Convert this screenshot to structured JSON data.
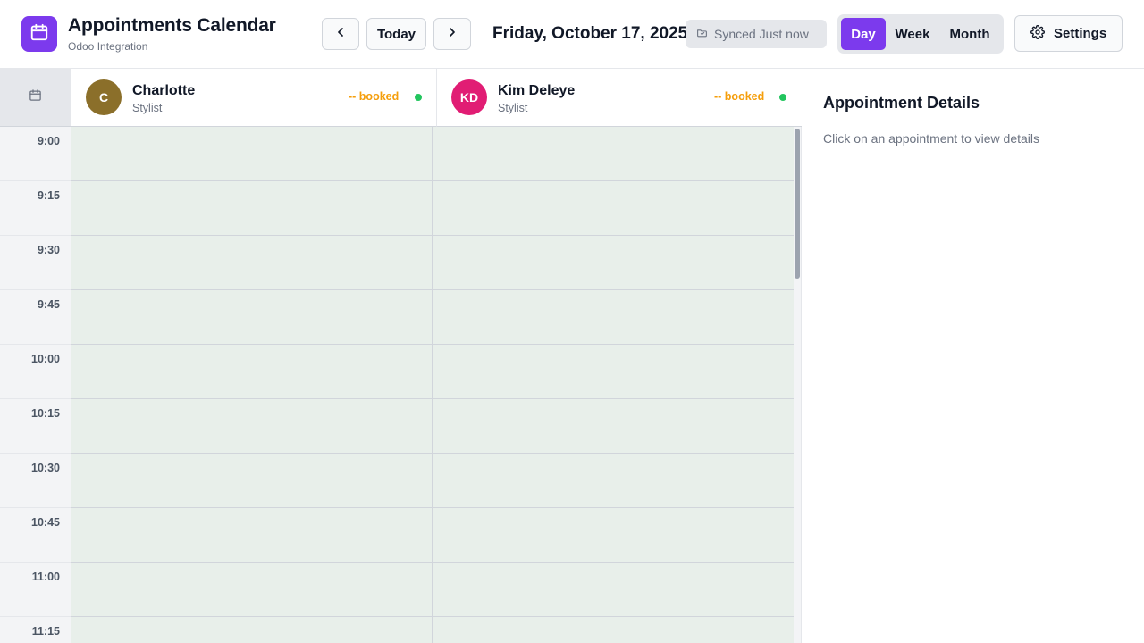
{
  "app": {
    "title": "Appointments Calendar",
    "subtitle": "Odoo Integration",
    "logo_icon": "calendar-icon",
    "brand_color": "#7c3aed"
  },
  "toolbar": {
    "prev_icon": "chevron-left-icon",
    "today_label": "Today",
    "next_icon": "chevron-right-icon",
    "current_date": "Friday, October 17, 2025",
    "sync_status": "Synced Just now",
    "sync_icon": "sync-icon",
    "views": [
      {
        "label": "Day",
        "active": true
      },
      {
        "label": "Week",
        "active": false
      },
      {
        "label": "Month",
        "active": false
      }
    ],
    "settings_label": "Settings",
    "settings_icon": "gear-icon"
  },
  "calendar": {
    "corner_icon": "calendar-icon",
    "staff": [
      {
        "initials": "C",
        "name": "Charlotte",
        "role": "Stylist",
        "booked": "-- booked",
        "avatar_color": "#8b6f2a",
        "status_color": "#22c55e"
      },
      {
        "initials": "KD",
        "name": "Kim Deleye",
        "role": "Stylist",
        "booked": "-- booked",
        "avatar_color": "#e11d74",
        "status_color": "#22c55e"
      }
    ],
    "time_slots": [
      "9:00",
      "9:15",
      "9:30",
      "9:45",
      "10:00",
      "10:15",
      "10:30",
      "10:45",
      "11:00",
      "11:15"
    ],
    "slot_color": "#e8efea"
  },
  "details": {
    "title": "Appointment Details",
    "hint": "Click on an appointment to view details"
  }
}
